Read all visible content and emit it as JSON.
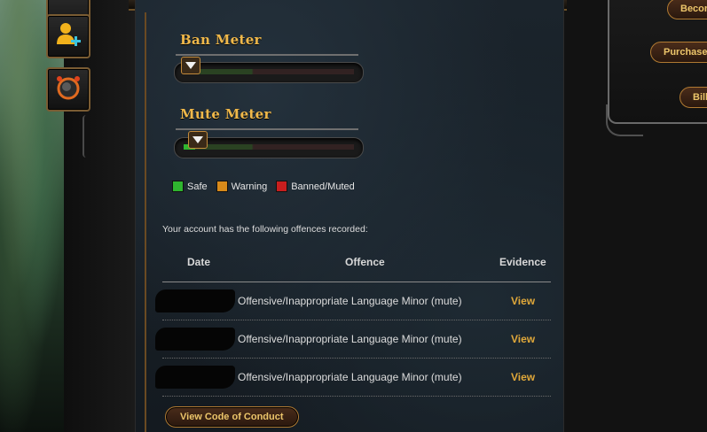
{
  "sidebar": {
    "buttons": [
      {
        "icon": "add-friend-icon"
      },
      {
        "icon": "bomb-icon"
      }
    ]
  },
  "meters": {
    "ban": {
      "title": "Ban Meter",
      "level": 0.04
    },
    "mute": {
      "title": "Mute Meter",
      "level": 0.07
    }
  },
  "legend": [
    {
      "label": "Safe",
      "color": "#2fb52f"
    },
    {
      "label": "Warning",
      "color": "#d88a1a"
    },
    {
      "label": "Banned/Muted",
      "color": "#c81e1e"
    }
  ],
  "offences": {
    "intro": "Your account has the following offences recorded:",
    "headers": {
      "date": "Date",
      "offence": "Offence",
      "evidence": "Evidence"
    },
    "rows": [
      {
        "date": "",
        "offence": "Offensive/Inappropriate Language Minor (mute)",
        "evidence": "View"
      },
      {
        "date": "",
        "offence": "Offensive/Inappropriate Language Minor (mute)",
        "evidence": "View"
      },
      {
        "date": "",
        "offence": "Offensive/Inappropriate Language Minor (mute)",
        "evidence": "View"
      }
    ]
  },
  "actions": {
    "conduct_label": "View Code of Conduct"
  },
  "account_panel": {
    "buttons": [
      "Becor",
      "Purchase",
      "Billi"
    ]
  }
}
